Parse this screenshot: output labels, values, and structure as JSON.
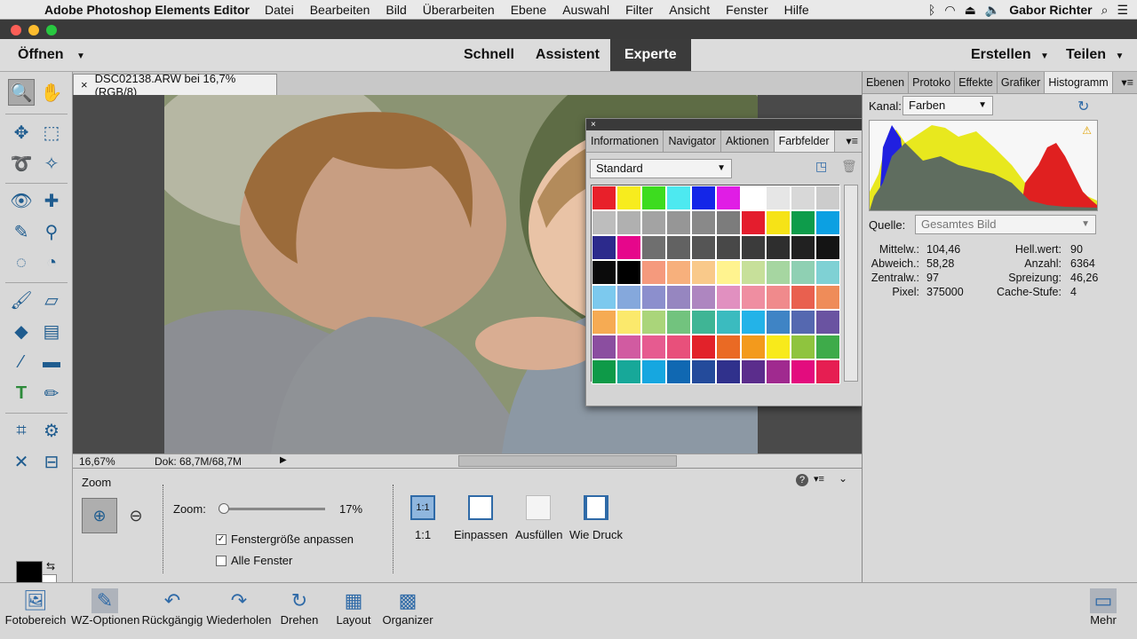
{
  "menubar": {
    "apple": "",
    "app": "Adobe Photoshop Elements Editor",
    "items": [
      "Datei",
      "Bearbeiten",
      "Bild",
      "Überarbeiten",
      "Ebene",
      "Auswahl",
      "Filter",
      "Ansicht",
      "Fenster",
      "Hilfe"
    ],
    "user": "Gabor Richter"
  },
  "appbar": {
    "open": "Öffnen",
    "modes": [
      "Schnell",
      "Assistent",
      "Experte"
    ],
    "create": "Erstellen",
    "share": "Teilen"
  },
  "document": {
    "tab_title": "DSC02138.ARW bei 16,7% (RGB/8)",
    "close": "×"
  },
  "status": {
    "zoom": "16,67%",
    "doc": "Dok: 68,7M/68,7M"
  },
  "swatches_panel": {
    "close": "×",
    "tabs": [
      "Informationen",
      "Navigator",
      "Aktionen",
      "Farbfelder"
    ],
    "preset": "Standard",
    "colors": [
      "#e8202a",
      "#f7ec1e",
      "#3ddc1f",
      "#4de9f0",
      "#1426e8",
      "#e01de5",
      "#ffffff",
      "#e6e6e6",
      "#d8d8d8",
      "#cccccc",
      "#bdbdbd",
      "#b0b0b0",
      "#a3a3a3",
      "#969696",
      "#898989",
      "#7c7c7c",
      "#e41d2d",
      "#f6e317",
      "#0e9c4b",
      "#0ca0e2",
      "#2c2a8c",
      "#e6068b",
      "#6f6f6f",
      "#626262",
      "#555555",
      "#484848",
      "#3b3b3b",
      "#2e2e2e",
      "#212121",
      "#141414",
      "#0b0b0b",
      "#000000",
      "#f59a7d",
      "#f7b07c",
      "#f9c98a",
      "#fff38f",
      "#c7e09a",
      "#a6d6a1",
      "#8fd0b3",
      "#7fd1d4",
      "#7cc9ee",
      "#85a8dc",
      "#8c8fcd",
      "#9686c0",
      "#ae86c0",
      "#e190c0",
      "#ef8ea1",
      "#f08a8c",
      "#e9604f",
      "#ef8c59",
      "#f6ab53",
      "#fbe96c",
      "#aad57a",
      "#72c37e",
      "#3fb595",
      "#3bbbbf",
      "#23b3e8",
      "#3f84c5",
      "#5568b0",
      "#6a53a1",
      "#8b4ea0",
      "#d15ba1",
      "#e65b90",
      "#e8507b",
      "#e2222a",
      "#ea6a24",
      "#f39a1c",
      "#f8ea1b",
      "#8fc43e",
      "#3eab4a",
      "#0e9a48",
      "#17a899",
      "#16a7e0",
      "#1068b2",
      "#244b9b",
      "#30318c",
      "#5b2d8c",
      "#a02a8f",
      "#e30c7e",
      "#e61e52"
    ]
  },
  "right_panel": {
    "tabs": [
      "Ebenen",
      "Protoko",
      "Effekte",
      "Grafiker",
      "Histogramm"
    ],
    "channel_label": "Kanal:",
    "channel_value": "Farben",
    "source_label": "Quelle:",
    "source_value": "Gesamtes Bild",
    "stats_left": [
      {
        "k": "Mittelw.:",
        "v": "104,46"
      },
      {
        "k": "Abweich.:",
        "v": "58,28"
      },
      {
        "k": "Zentralw.:",
        "v": "97"
      },
      {
        "k": "Pixel:",
        "v": "375000"
      }
    ],
    "stats_right": [
      {
        "k": "Hell.wert:",
        "v": "90"
      },
      {
        "k": "Anzahl:",
        "v": "6364"
      },
      {
        "k": "Spreizung:",
        "v": "46,26"
      },
      {
        "k": "Cache-Stufe:",
        "v": "4"
      }
    ]
  },
  "options": {
    "title": "Zoom",
    "zoom_label": "Zoom:",
    "zoom_value": "17%",
    "zoom_level": 0.17,
    "fit_window": "Fenstergröße anpassen",
    "all_windows": "Alle Fenster",
    "btn_11": "1:1",
    "btn_11_label": "1:1",
    "fit": "Einpassen",
    "fill": "Ausfüllen",
    "print": "Wie Druck",
    "help": "?"
  },
  "bottombar": {
    "items": [
      "Fotobereich",
      "WZ-Optionen",
      "Rückgängig",
      "Wiederholen",
      "Drehen",
      "Layout",
      "Organizer"
    ],
    "more": "Mehr"
  },
  "colors": {
    "accent": "#2f6aa7",
    "active_mode": "#3b3b3b"
  }
}
